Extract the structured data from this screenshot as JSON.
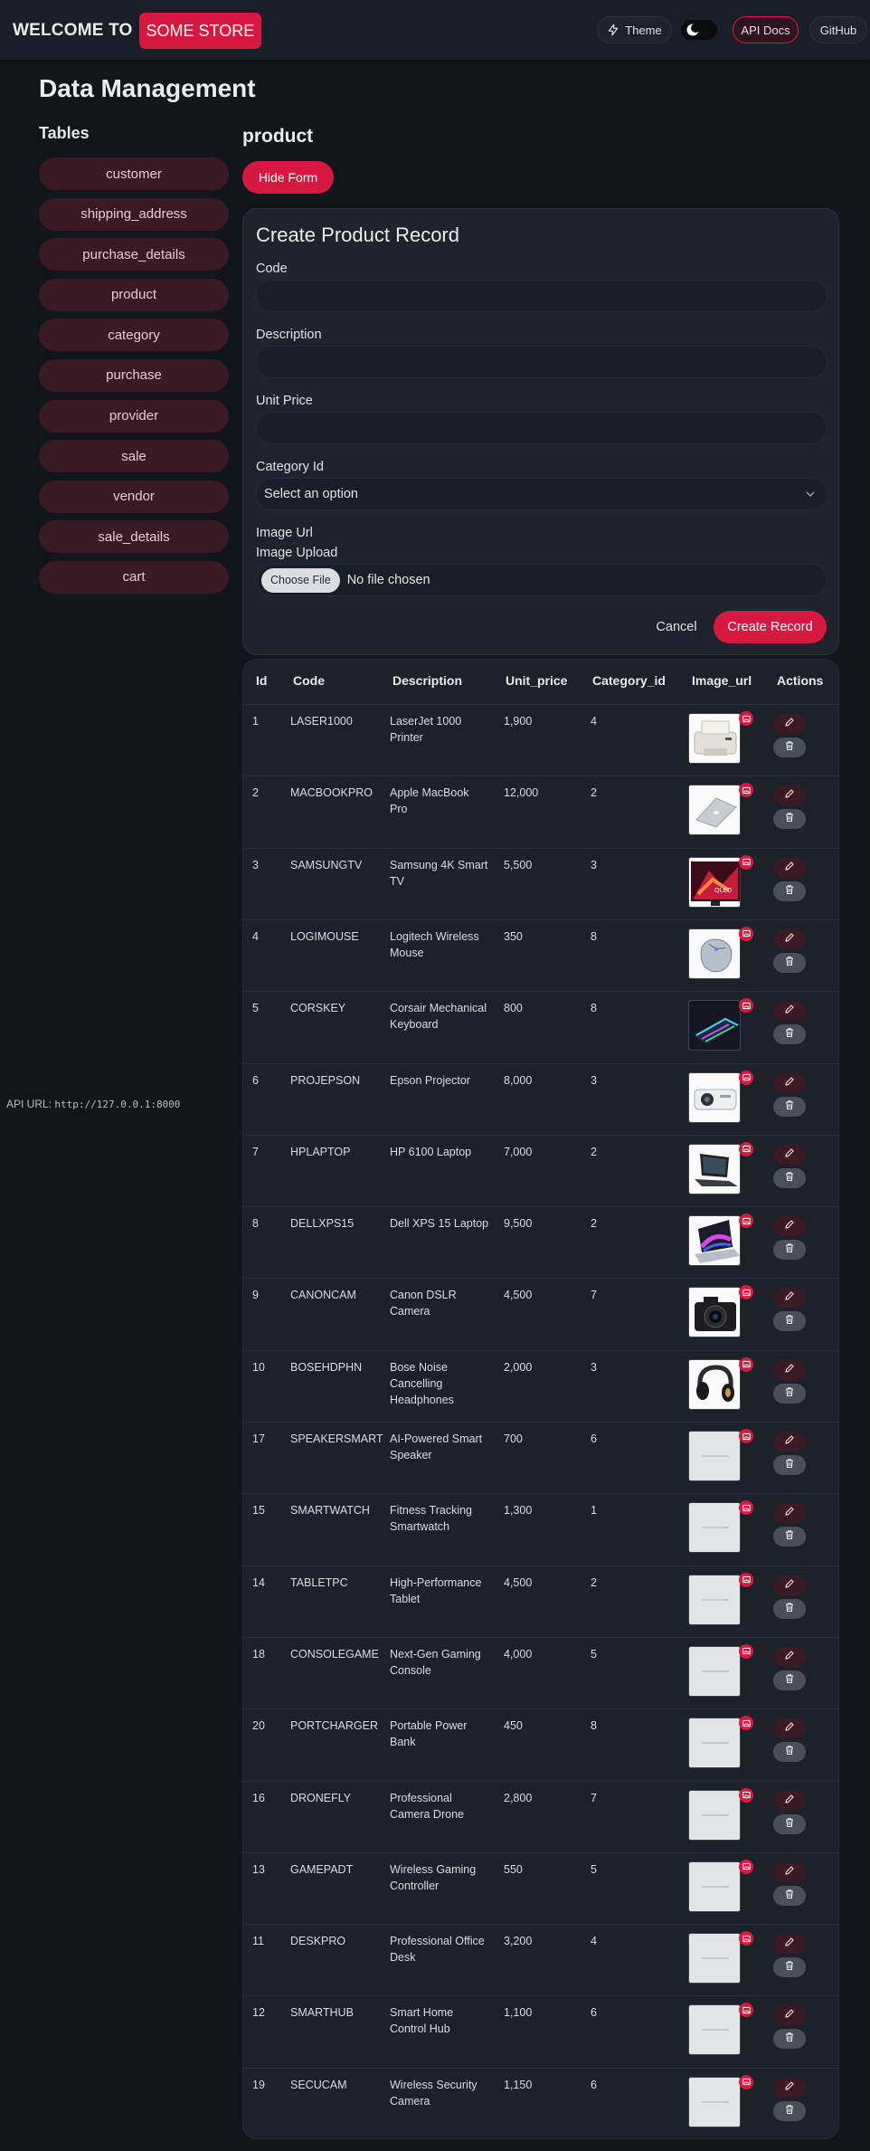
{
  "nav": {
    "brand_prefix": "WELCOME TO",
    "brand_name": "SOME STORE",
    "theme_label": "Theme",
    "api_docs_label": "API Docs",
    "github_label": "GitHub"
  },
  "page": {
    "title": "Data Management",
    "tables_heading": "Tables",
    "api_url_label": "API URL:",
    "api_url": "http://127.0.0.1:8000"
  },
  "sidebar": {
    "items": [
      {
        "label": "customer"
      },
      {
        "label": "shipping_address"
      },
      {
        "label": "purchase_details"
      },
      {
        "label": "product"
      },
      {
        "label": "category"
      },
      {
        "label": "purchase"
      },
      {
        "label": "provider"
      },
      {
        "label": "sale"
      },
      {
        "label": "vendor"
      },
      {
        "label": "sale_details"
      },
      {
        "label": "cart"
      }
    ]
  },
  "section": {
    "title": "product",
    "hide_form_label": "Hide Form"
  },
  "form": {
    "title": "Create Product Record",
    "code_label": "Code",
    "code_value": "",
    "description_label": "Description",
    "description_value": "",
    "unit_price_label": "Unit Price",
    "unit_price_value": "",
    "category_label": "Category Id",
    "category_selected": "Select an option",
    "image_url_label": "Image Url",
    "image_upload_label": "Image Upload",
    "choose_file_label": "Choose File",
    "file_status": "No file chosen",
    "cancel_label": "Cancel",
    "submit_label": "Create Record"
  },
  "table": {
    "columns": [
      "Id",
      "Code",
      "Description",
      "Unit_price",
      "Category_id",
      "Image_url",
      "Actions"
    ],
    "rows": [
      {
        "id": "1",
        "code": "LASER1000",
        "description": "LaserJet 1000 Printer",
        "unit_price": "1,900",
        "category_id": "4",
        "image": "printer"
      },
      {
        "id": "2",
        "code": "MACBOOKPRO",
        "description": "Apple MacBook Pro",
        "unit_price": "12,000",
        "category_id": "2",
        "image": "macbook"
      },
      {
        "id": "3",
        "code": "SAMSUNGTV",
        "description": "Samsung 4K Smart TV",
        "unit_price": "5,500",
        "category_id": "3",
        "image": "tv"
      },
      {
        "id": "4",
        "code": "LOGIMOUSE",
        "description": "Logitech Wireless Mouse",
        "unit_price": "350",
        "category_id": "8",
        "image": "mouse"
      },
      {
        "id": "5",
        "code": "CORSKEY",
        "description": "Corsair Mechanical Keyboard",
        "unit_price": "800",
        "category_id": "8",
        "image": "keyboard"
      },
      {
        "id": "6",
        "code": "PROJEPSON",
        "description": "Epson Projector",
        "unit_price": "8,000",
        "category_id": "3",
        "image": "projector"
      },
      {
        "id": "7",
        "code": "HPLAPTOP",
        "description": "HP 6100 Laptop",
        "unit_price": "7,000",
        "category_id": "2",
        "image": "laptop"
      },
      {
        "id": "8",
        "code": "DELLXPS15",
        "description": "Dell XPS 15 Laptop",
        "unit_price": "9,500",
        "category_id": "2",
        "image": "xps"
      },
      {
        "id": "9",
        "code": "CANONCAM",
        "description": "Canon DSLR Camera",
        "unit_price": "4,500",
        "category_id": "7",
        "image": "camera"
      },
      {
        "id": "10",
        "code": "BOSEHDPHN",
        "description": "Bose Noise Cancelling Headphones",
        "unit_price": "2,000",
        "category_id": "3",
        "image": "headphones"
      },
      {
        "id": "17",
        "code": "SPEAKERSMART",
        "description": "AI-Powered Smart Speaker",
        "unit_price": "700",
        "category_id": "6",
        "image": "placeholder"
      },
      {
        "id": "15",
        "code": "SMARTWATCH",
        "description": "Fitness Tracking Smartwatch",
        "unit_price": "1,300",
        "category_id": "1",
        "image": "placeholder"
      },
      {
        "id": "14",
        "code": "TABLETPC",
        "description": "High-Performance Tablet",
        "unit_price": "4,500",
        "category_id": "2",
        "image": "placeholder"
      },
      {
        "id": "18",
        "code": "CONSOLEGAME",
        "description": "Next-Gen Gaming Console",
        "unit_price": "4,000",
        "category_id": "5",
        "image": "placeholder"
      },
      {
        "id": "20",
        "code": "PORTCHARGER",
        "description": "Portable Power Bank",
        "unit_price": "450",
        "category_id": "8",
        "image": "placeholder"
      },
      {
        "id": "16",
        "code": "DRONEFLY",
        "description": "Professional Camera Drone",
        "unit_price": "2,800",
        "category_id": "7",
        "image": "placeholder"
      },
      {
        "id": "13",
        "code": "GAMEPADT",
        "description": "Wireless Gaming Controller",
        "unit_price": "550",
        "category_id": "5",
        "image": "placeholder"
      },
      {
        "id": "11",
        "code": "DESKPRO",
        "description": "Professional Office Desk",
        "unit_price": "3,200",
        "category_id": "4",
        "image": "placeholder"
      },
      {
        "id": "12",
        "code": "SMARTHUB",
        "description": "Smart Home Control Hub",
        "unit_price": "1,100",
        "category_id": "6",
        "image": "placeholder"
      },
      {
        "id": "19",
        "code": "SECUCAM",
        "description": "Wireless Security Camera",
        "unit_price": "1,150",
        "category_id": "6",
        "image": "placeholder"
      }
    ]
  },
  "icons": {
    "theme": "lightning-icon",
    "toggle": "moon-icon",
    "select": "chevron-down-icon",
    "image_badge": "image-icon",
    "edit": "pencil-icon",
    "delete": "trash-icon"
  },
  "colors": {
    "accent": "#d8193f",
    "background": "#12151c",
    "surface": "#1f232c",
    "pill": "#3a1a25"
  }
}
